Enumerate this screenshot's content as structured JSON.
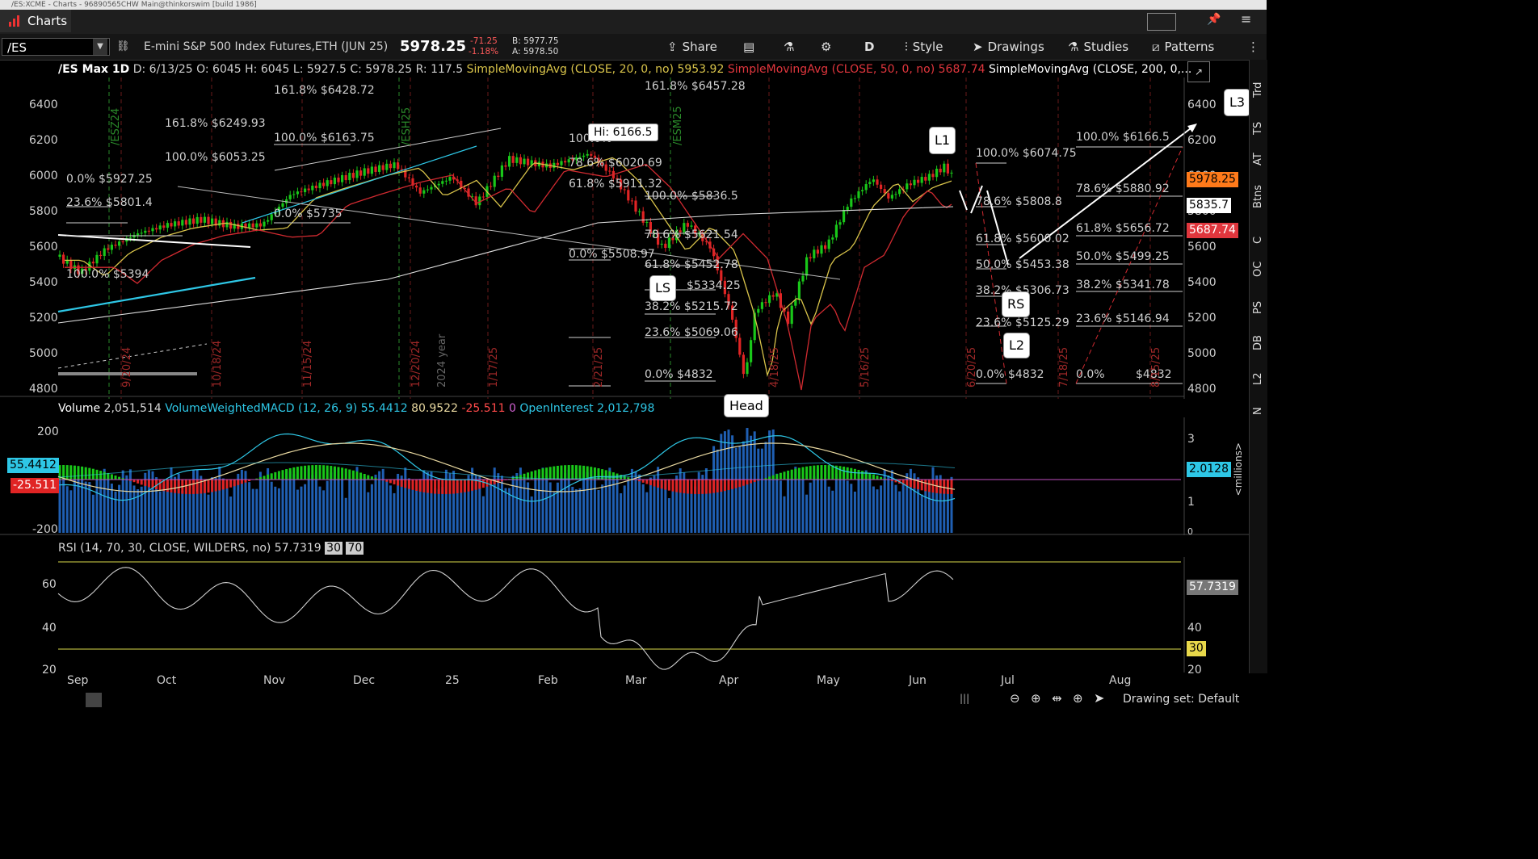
{
  "window": {
    "title": "/ES:XCME - Charts - 96890565CHW Main@thinkorswim [build 1986]"
  },
  "app": {
    "tab_label": "Charts"
  },
  "toolbar": {
    "symbol": "/ES",
    "description": "E-mini S&P 500 Index Futures,ETH (JUN 25)",
    "last": "5978.25",
    "change": "-71.25",
    "change_pct": "-1.18%",
    "bid": "B: 5977.75",
    "ask": "A: 5978.50",
    "share": "Share",
    "timeframe": "D",
    "style": "Style",
    "drawings": "Drawings",
    "studies": "Studies",
    "patterns": "Patterns"
  },
  "ohlc": {
    "symbol_agg": "/ES Max 1D",
    "date": "D: 6/13/25",
    "open": "O: 6045",
    "high": "H: 6045",
    "low": "L: 5927.5",
    "close": "C: 5978.25",
    "range": "R: 117.5",
    "sma20": "SimpleMovingAvg (CLOSE, 20, 0, no)",
    "sma20_val": "5953.92",
    "sma50": "SimpleMovingAvg (CLOSE, 50, 0, no)",
    "sma50_val": "5687.74",
    "sma200": "SimpleMovingAvg (CLOSE, 200, 0,..."
  },
  "price_axis": {
    "ticks": [
      "6400",
      "6200",
      "6000",
      "5800",
      "5600",
      "5400",
      "5200",
      "5000",
      "4800"
    ],
    "last_badge": "5978.25",
    "sma20_badge": "5835.7",
    "sma50_badge": "5687.74"
  },
  "fib_labels": [
    "161.8%  $6428.72",
    "100.0%  $6163.75",
    "161.8%  $6249.93",
    "100.0%  $6053.25",
    "0.0%  $5927.25",
    "23.6%  $5801.4",
    "0.0%  $5735",
    "100.0%  $5394",
    "161.8%  $6457.28",
    "100.0%",
    "78.6%  $6020.69",
    "61.8%  $5911.32",
    "0.0%  $5508.97",
    "100.0%  $5836.5",
    "78.6%  $5621.54",
    "61.8%  $5452.78",
    "$5334.25",
    "38.2%  $5215.72",
    "23.6%  $5069.06",
    "0.0%  $4832",
    "100.0%  $6074.75",
    "78.6%  $5808.8",
    "61.8%  $5600.02",
    "50.0%  $5453.38",
    "38.2%  $5306.73",
    "23.6%  $5125.29",
    "0.0%  $4832",
    "100.0%  $6166.5",
    "78.6%  $5880.92",
    "61.8%  $5656.72",
    "50.0%  $5499.25",
    "38.2%  $5341.78",
    "23.6%  $5146.94",
    "0.0%",
    "$4832"
  ],
  "annotations": {
    "hi": "Hi: 6166.5",
    "l1": "L1",
    "l2": "L2",
    "l3": "L3",
    "ls": "LS",
    "rs": "RS",
    "head": "Head"
  },
  "vertical_dates": [
    "9/20/24",
    "10/18/24",
    "11/15/24",
    "12/20/24",
    "2024 year",
    "1/17/25",
    "2/21/25",
    "4/18/25",
    "5/16/25",
    "6/20/25",
    "7/18/25",
    "8/15/25",
    "/ESZ24",
    "/ESH25",
    "/ESM25"
  ],
  "volume_panel": {
    "volume_label": "Volume",
    "volume_val": "2,051,514",
    "macd_label": "VolumeWeightedMACD (12, 26, 9)",
    "macd_val": "55.4412",
    "signal_val": "80.9522",
    "diff_val": "-25.511",
    "zero": "0",
    "oi_label": "OpenInterest",
    "oi_val": "2,012,798",
    "left_ticks": [
      "200",
      "-200"
    ],
    "right_ticks": [
      "3",
      "2",
      "1",
      "0"
    ],
    "badge_macd": "55.4412",
    "badge_diff": "-25.511",
    "badge_oi": "2.0128",
    "unit": "<millions>"
  },
  "rsi_panel": {
    "label": "RSI (14, 70, 30, CLOSE, WILDERS, no)",
    "value": "57.7319",
    "ob": "30",
    "os": "70",
    "ticks": [
      "60",
      "40",
      "20"
    ],
    "badge_val": "57.7319",
    "badge_30": "30"
  },
  "time_axis": [
    "Sep",
    "Oct",
    "Nov",
    "Dec",
    "25",
    "Feb",
    "Mar",
    "Apr",
    "May",
    "Jun",
    "Jul",
    "Aug"
  ],
  "right_rail": [
    "Trd",
    "TS",
    "AT",
    "Btns",
    "C",
    "OC",
    "PS",
    "DB",
    "L2",
    "N"
  ],
  "status": {
    "drawing_set": "Drawing set: Default"
  },
  "colors": {
    "up": "#19c719",
    "down": "#e02424",
    "sma20": "#d8c34a",
    "sma50": "#d02a30",
    "sma200": "#dddddd",
    "cyan": "#2ec7e6",
    "blue_vol": "#1f5fb3"
  }
}
